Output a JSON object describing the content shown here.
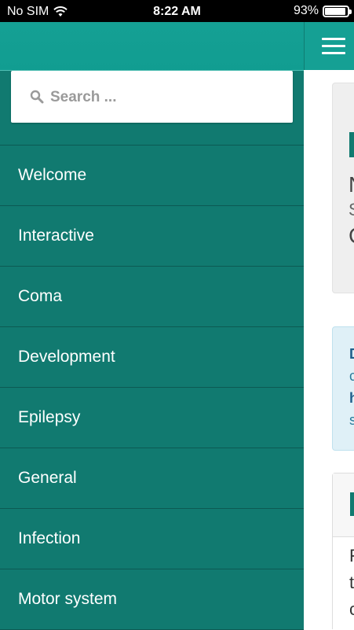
{
  "status_bar": {
    "carrier": "No SIM",
    "time": "8:22 AM",
    "battery_text": "93%",
    "battery_level": 0.93
  },
  "search": {
    "placeholder": "Search ..."
  },
  "nav": {
    "items": [
      {
        "label": "Welcome"
      },
      {
        "label": "Interactive"
      },
      {
        "label": "Coma"
      },
      {
        "label": "Development"
      },
      {
        "label": "Epilepsy"
      },
      {
        "label": "General"
      },
      {
        "label": "Infection"
      },
      {
        "label": "Motor system"
      }
    ]
  },
  "content_peek": {
    "card1_letters": [
      "N",
      "S",
      "C"
    ],
    "card2_letters": [
      "D",
      "c",
      "h",
      "s"
    ],
    "card3_letters": [
      "F",
      "t",
      "c"
    ]
  },
  "colors": {
    "sidebar": "#117a70",
    "header": "#15a094",
    "divider": "#0c5a53"
  }
}
